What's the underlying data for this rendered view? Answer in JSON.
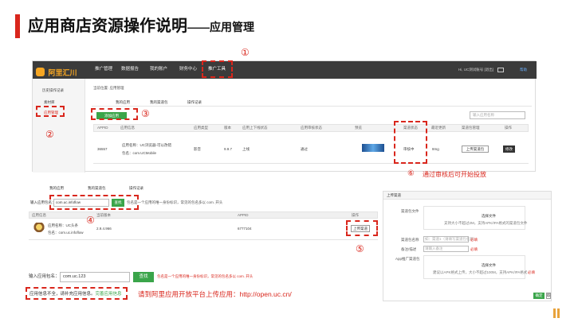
{
  "slide": {
    "title_main": "应用商店资源操作说明",
    "title_dash": "——",
    "title_sub": "应用管理"
  },
  "callouts": {
    "c1": "①",
    "c2": "②",
    "c3": "③",
    "c4": "④",
    "c5": "⑤",
    "c6": "⑥",
    "c6_text": "通过审核后可开始投放"
  },
  "console": {
    "logo_text": "阿里汇川",
    "nav": [
      "推广管理",
      "数据报告",
      "我的账户",
      "财务中心",
      "推广工具"
    ],
    "user": "Hi, UC测试账号 [退出]",
    "mail_icon": "mail-icon",
    "help": "帮助",
    "sidebar": {
      "item1": "历史操作记录",
      "item2": "素材库",
      "item3": "应用管理"
    },
    "breadcrumb": "当前位置: 应用管理",
    "tabs": [
      "我的应用",
      "我的渠道包",
      "操作记录"
    ],
    "add_button": "添加应用",
    "search_placeholder": "输入应用名称",
    "table_headers": [
      "APPID",
      "应用信息",
      "应用类型",
      "版本",
      "应用上下线状态",
      "应用审核状态",
      "预览",
      "渠道状态",
      "最近更新",
      "渠道包管理",
      "操作"
    ],
    "row": {
      "appid": "36557",
      "name": "应用名称：UC浏览器-可以改错",
      "package": "包名：com.UCMobile",
      "type": "影音",
      "version": "9.9.7",
      "online": "上线",
      "audit": "通过",
      "channel_status": "审核中",
      "updated": "8mg",
      "upload_button": "上传渠道包",
      "op_button": "修改"
    }
  },
  "section2": {
    "tabs": [
      "我的应用",
      "我的渠道包",
      "操作记录"
    ],
    "label": "输入应用包名：",
    "input_value": "com.uc.infoflow",
    "search_button": "查找",
    "hint": "包名是一个应用的唯一身份标识，常见的包名多以 com. 开头",
    "headers": [
      "应用信息",
      "当前版本",
      "APPID",
      "操作"
    ],
    "app_name": "应用名称：UC头条",
    "app_package": "包名：com.uc.infoflow",
    "version": "2.9.4.966",
    "appid": "6777104",
    "upload_button": "上传渠道"
  },
  "section3": {
    "label": "输入应用包名：",
    "input_value": "com.uc.123",
    "search_button": "查找",
    "hint": "包名是一个应用的唯一身份标识，常见的包名多以 com. 开头",
    "notice": "应用信息不全，请补充应用信息。",
    "notice_link": "完善应用信息",
    "instruction": "请到阿里应用开放平台上传应用：http://open.uc.cn/"
  },
  "upload_dialog": {
    "title": "上传渠道",
    "label1": "渠道包文件",
    "select1": "选择文件",
    "hint1": "支持大小不超过2M，支持APK/IPA格式的渠道包文件",
    "label2": "渠道包名称",
    "placeholder2": "如：渠道1（请填写渠道包名称）",
    "label3": "备注/描述",
    "placeholder3": "请输入备注",
    "label4": "App推广渠道包",
    "select2": "选择文件",
    "hint2": "建议以APK格式上传，大小不超过100M，支持APK/IPA格式",
    "required": "必填",
    "ok_button": "确定",
    "cancel_button": "取消"
  },
  "colors": {
    "title_bar": "#d9261c",
    "accent_red": "#d9261c",
    "nav_bg": "#3b3b3b",
    "button_green": "#3aa54a",
    "logo_orange": "#f6a623",
    "corner_marks": "#e8a33c"
  }
}
